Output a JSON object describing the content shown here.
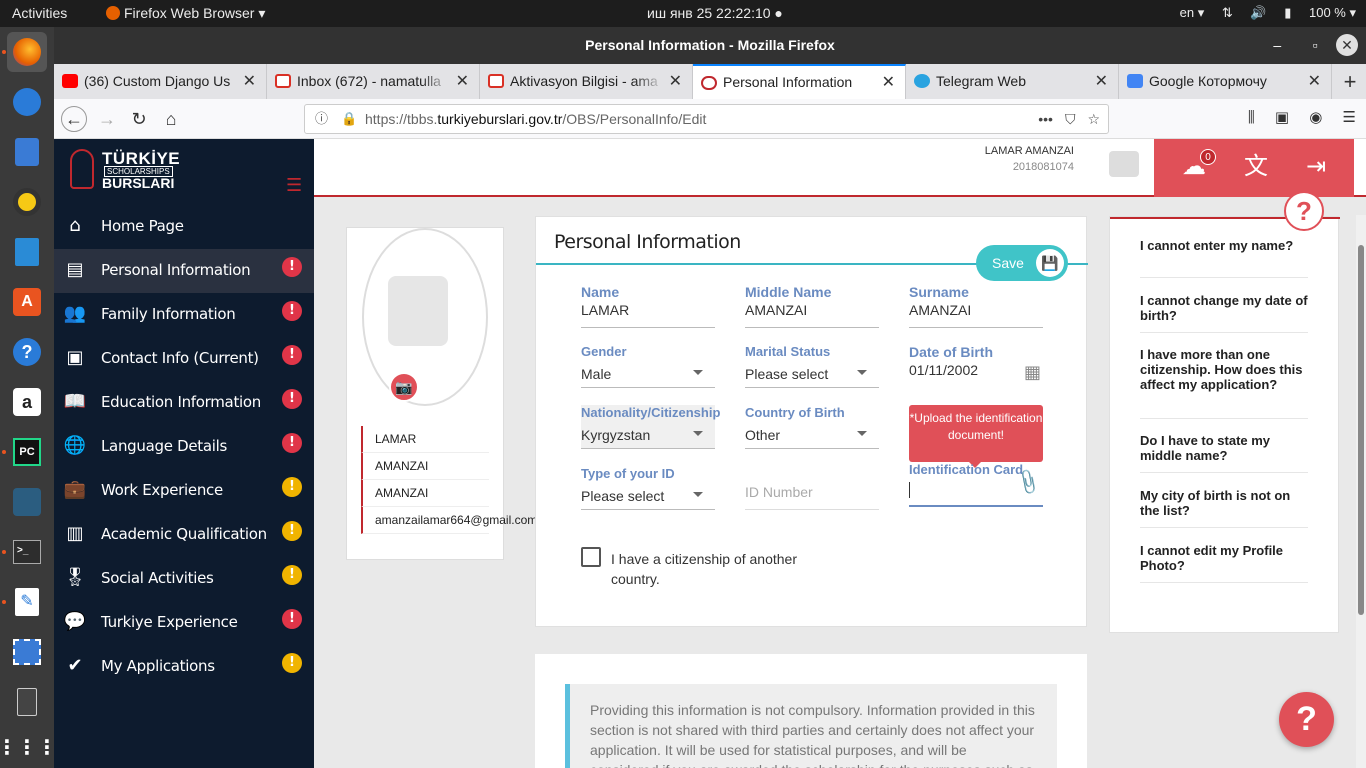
{
  "system": {
    "activities": "Activities",
    "app_name": "Firefox Web Browser ▾",
    "clock": "иш янв 25  22:22:10 ●",
    "lang": "en ▾",
    "battery": "100 %"
  },
  "window": {
    "title": "Personal Information - Mozilla Firefox"
  },
  "tabs": [
    {
      "label": "(36) Custom Django Us",
      "icon_color": "#ff0000"
    },
    {
      "label": "Inbox (672) - namatulla",
      "icon_color": "#d93025"
    },
    {
      "label": "Aktivasyon Bilgisi - ama",
      "icon_color": "#d93025"
    },
    {
      "label": "Personal Information",
      "icon_color": "#c0282e"
    },
    {
      "label": "Telegram Web",
      "icon_color": "#2aa3e0"
    },
    {
      "label": "Google Котормочу",
      "icon_color": "#4285f4"
    }
  ],
  "url": {
    "prefix": "https://tbbs.",
    "domain": "turkiyeburslari.gov.tr",
    "path": "/OBS/PersonalInfo/Edit"
  },
  "logo": {
    "line1": "TÜRKİYE",
    "line2": "SCHOLARSHIPS",
    "line3": "BURSLARI"
  },
  "sidebar": {
    "items": [
      {
        "label": "Home Page",
        "icon": "home-icon",
        "glyph": "⌂"
      },
      {
        "label": "Personal Information",
        "icon": "id-card-icon",
        "glyph": "▤"
      },
      {
        "label": "Family Information",
        "icon": "people-icon",
        "glyph": "👥"
      },
      {
        "label": "Contact Info (Current)",
        "icon": "contact-card-icon",
        "glyph": "▣"
      },
      {
        "label": "Education Information",
        "icon": "book-icon",
        "glyph": "📖"
      },
      {
        "label": "Language Details",
        "icon": "globe-icon",
        "glyph": "🌐"
      },
      {
        "label": "Work Experience",
        "icon": "briefcase-icon",
        "glyph": "💼"
      },
      {
        "label": "Academic Qualification",
        "icon": "qualification-icon",
        "glyph": "▥"
      },
      {
        "label": "Social Activities",
        "icon": "medal-icon",
        "glyph": "🎖"
      },
      {
        "label": "Turkiye Experience",
        "icon": "chat-icon",
        "glyph": "💬"
      },
      {
        "label": "My Applications",
        "icon": "shield-check-icon",
        "glyph": "✔"
      }
    ],
    "badge_red": "#e03548",
    "badge_yellow": "#f0b400"
  },
  "header": {
    "user_name": "LAMAR AMANZAI",
    "user_id": "2018081074",
    "upload_count": "0"
  },
  "profile": {
    "first": "LAMAR",
    "middle": "AMANZAI",
    "last": "AMANZAI",
    "email": "amanzailamar664@gmail.com"
  },
  "form": {
    "title": "Personal Information",
    "save_label": "Save",
    "name_label": "Name",
    "name_value": "LAMAR",
    "middle_label": "Middle Name",
    "middle_value": "AMANZAI",
    "surname_label": "Surname",
    "surname_value": "AMANZAI",
    "gender_label": "Gender",
    "gender_value": "Male",
    "marital_label": "Marital Status",
    "marital_value": "Please select",
    "dob_label": "Date of Birth",
    "dob_value": "01/11/2002",
    "nationality_label": "Nationality/Citizenship",
    "nationality_value": "Kyrgyzstan",
    "country_birth_label": "Country of Birth",
    "country_birth_value": "Other",
    "upload_tip": "*Upload the identification document!",
    "id_type_label": "Type of your ID",
    "id_type_value": "Please select",
    "id_number_placeholder": "ID Number",
    "id_card_label": "Identification Card",
    "citizenship_check_label": "I have a citizenship of another country."
  },
  "faq": [
    "I cannot enter my name?",
    "I cannot change my date of birth?",
    "I have more than one citizenship. How does this affect my application?",
    "Do I have to state my middle name?",
    "My city of birth is not on the list?",
    "I cannot edit my Profile Photo?"
  ],
  "info_text": "Providing this information is not compulsory. Information provided in this section is not shared with third parties and certainly does not affect your application. It will be used for statistical purposes, and will be considered if you are awarded the scholarship for the purposes such as placing you"
}
